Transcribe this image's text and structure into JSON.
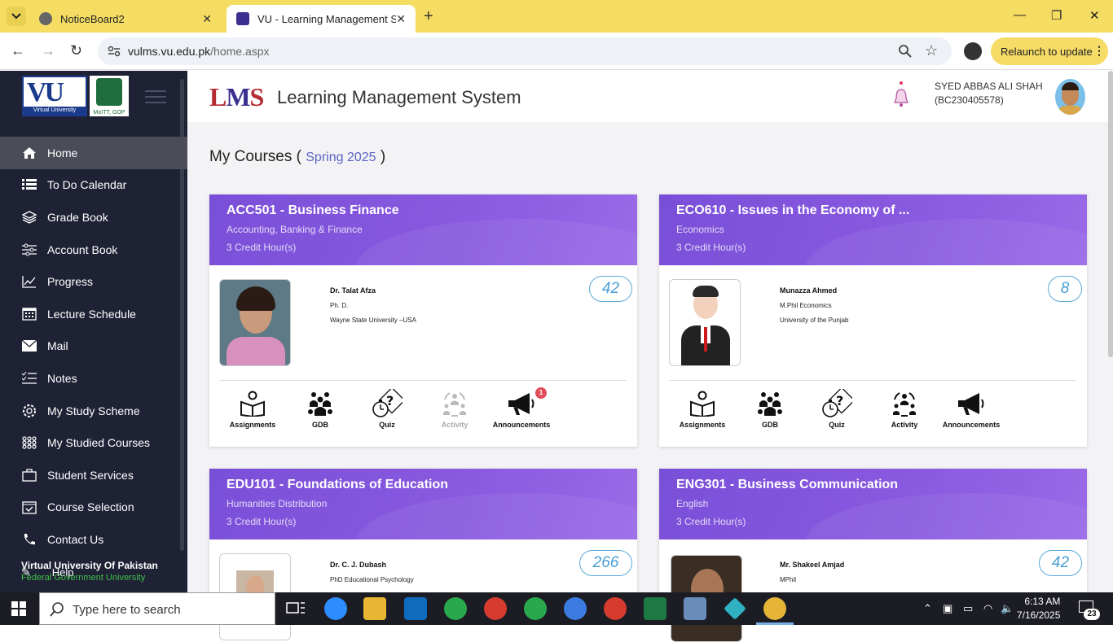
{
  "browser": {
    "tabs": [
      {
        "title": "NoticeBoard2"
      },
      {
        "title": "VU - Learning Management Sys"
      }
    ],
    "url_host": "vulms.vu.edu.pk",
    "url_path": "/home.aspx",
    "relaunch_label": "Relaunch to update"
  },
  "sidebar": {
    "logo_big": "VU",
    "logo_small": "Virtual University",
    "gop_text": "MoITT, GOP",
    "items": [
      {
        "label": "Home",
        "icon": "home-icon"
      },
      {
        "label": "To Do Calendar",
        "icon": "list-icon"
      },
      {
        "label": "Grade Book",
        "icon": "layers-icon"
      },
      {
        "label": "Account Book",
        "icon": "sliders-icon"
      },
      {
        "label": "Progress",
        "icon": "chart-icon"
      },
      {
        "label": "Lecture Schedule",
        "icon": "calendar-icon"
      },
      {
        "label": "Mail",
        "icon": "mail-icon"
      },
      {
        "label": "Notes",
        "icon": "notes-icon"
      },
      {
        "label": "My Study Scheme",
        "icon": "gear-icon"
      },
      {
        "label": "My Studied Courses",
        "icon": "grid-icon"
      },
      {
        "label": "Student Services",
        "icon": "bag-icon"
      },
      {
        "label": "Course Selection",
        "icon": "calendar-check-icon"
      },
      {
        "label": "Contact Us",
        "icon": "phone-icon"
      },
      {
        "label": "Help",
        "icon": "help-icon"
      }
    ],
    "footer_title": "Virtual University Of Pakistan",
    "footer_sub": "Federal Government University"
  },
  "header": {
    "logo_text_l": "L",
    "logo_text_m": "M",
    "logo_text_s": "S",
    "title": "Learning Management System",
    "user_name": "SYED ABBAS ALI SHAH",
    "user_id": "(BC230405578)"
  },
  "main": {
    "heading": "My Courses",
    "paren_open": "(",
    "paren_close": ")",
    "semester": "Spring 2025"
  },
  "courses": [
    {
      "title": "ACC501 - Business Finance",
      "dept": "Accounting, Banking & Finance",
      "credit": "3 Credit Hour(s)",
      "count": "42",
      "instructor": "Dr. Talat Afza",
      "degree": "Ph. D.",
      "university": "Wayne State University –USA",
      "announcement_badge": "1"
    },
    {
      "title": "ECO610 - Issues in the Economy of ...",
      "dept": "Economics",
      "credit": "3 Credit Hour(s)",
      "count": "8",
      "instructor": "Munazza Ahmed",
      "degree": "M.Phil Economics",
      "university": "University of the Punjab"
    },
    {
      "title": "EDU101 - Foundations of Education",
      "dept": "Humanities Distribution",
      "credit": "3 Credit Hour(s)",
      "count": "266",
      "instructor": "Dr. C. J. Dubash",
      "degree": "PhD Educational Psychology",
      "university": ""
    },
    {
      "title": "ENG301 - Business Communication",
      "dept": "English",
      "credit": "3 Credit Hour(s)",
      "count": "42",
      "instructor": "Mr. Shakeel Amjad",
      "degree": "MPhil",
      "university": ""
    }
  ],
  "actions": {
    "assignments": "Assignments",
    "gdb": "GDB",
    "quiz": "Quiz",
    "activity": "Activity",
    "announcements": "Announcements"
  },
  "taskbar": {
    "search_placeholder": "Type here to search",
    "time": "6:13 AM",
    "date": "7/16/2025",
    "notifications": "23"
  }
}
